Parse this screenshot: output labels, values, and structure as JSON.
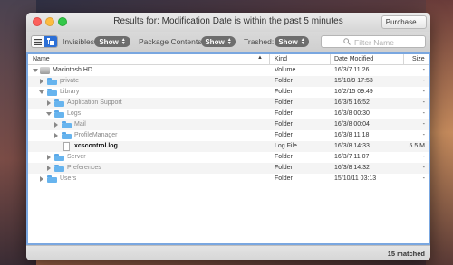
{
  "window": {
    "title": "Results for: Modification Date is within the past 5 minutes",
    "purchase_label": "Purchase..."
  },
  "toolbar": {
    "invisibles_label": "Invisibles:",
    "invisibles_value": "Show",
    "package_label": "Package Contents:",
    "package_value": "Show",
    "trashed_label": "Trashed:",
    "trashed_value": "Show",
    "search_placeholder": "Filter Name"
  },
  "columns": {
    "name": "Name",
    "kind": "Kind",
    "date": "Date Modified",
    "size": "Size"
  },
  "rows": [
    {
      "name": "Macintosh HD",
      "kind": "Volume",
      "date": "16/3/7 11:26",
      "size": "-"
    },
    {
      "name": "private",
      "kind": "Folder",
      "date": "15/10/9 17:53",
      "size": "-"
    },
    {
      "name": "Library",
      "kind": "Folder",
      "date": "16/2/15 09:49",
      "size": "-"
    },
    {
      "name": "Application Support",
      "kind": "Folder",
      "date": "16/3/5 16:52",
      "size": "-"
    },
    {
      "name": "Logs",
      "kind": "Folder",
      "date": "16/3/8 00:30",
      "size": "-"
    },
    {
      "name": "Mail",
      "kind": "Folder",
      "date": "16/3/8 00:04",
      "size": "-"
    },
    {
      "name": "ProfileManager",
      "kind": "Folder",
      "date": "16/3/8 11:18",
      "size": "-"
    },
    {
      "name": "xcscontrol.log",
      "kind": "Log File",
      "date": "16/3/8 14:33",
      "size": "5.5 M"
    },
    {
      "name": "Server",
      "kind": "Folder",
      "date": "16/3/7 11:07",
      "size": "-"
    },
    {
      "name": "Preferences",
      "kind": "Folder",
      "date": "16/3/8 14:32",
      "size": "-"
    },
    {
      "name": "Users",
      "kind": "Folder",
      "date": "15/10/11 03:13",
      "size": "-"
    }
  ],
  "status": {
    "matched": "15 matched"
  },
  "colors": {
    "accent": "#2c6fd6",
    "folder": "#67b4ee",
    "selection_border": "#7aa7e0"
  }
}
